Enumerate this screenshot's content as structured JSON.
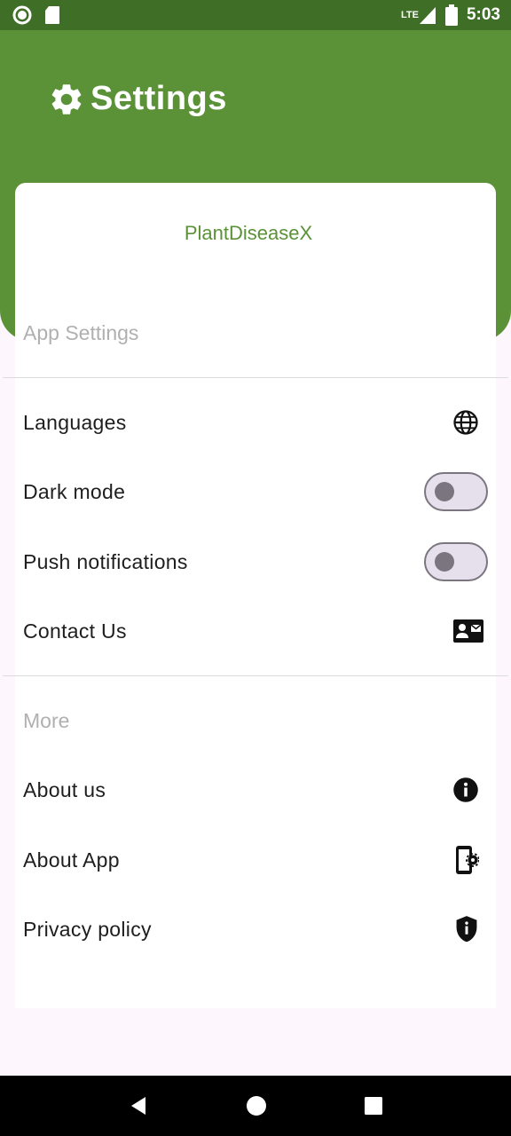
{
  "status_bar": {
    "network": "LTE",
    "time": "5:03",
    "icons": [
      "circle-status-icon",
      "sd-card-icon",
      "signal-icon",
      "battery-icon"
    ]
  },
  "header": {
    "title": "Settings",
    "icon": "gear-icon",
    "color": "#5b9238"
  },
  "app": {
    "name": "PlantDiseaseX"
  },
  "sections": {
    "app_settings": {
      "label": "App Settings",
      "items": {
        "languages": {
          "label": "Languages",
          "icon": "globe-icon"
        },
        "dark_mode": {
          "label": "Dark mode",
          "enabled": false
        },
        "push_notifications": {
          "label": "Push notifications",
          "enabled": false
        },
        "contact_us": {
          "label": "Contact Us",
          "icon": "contact-card-icon"
        }
      }
    },
    "more": {
      "label": "More",
      "items": {
        "about_us": {
          "label": "About us",
          "icon": "info-icon"
        },
        "about_app": {
          "label": "About App",
          "icon": "phone-settings-icon"
        },
        "privacy_policy": {
          "label": "Privacy policy",
          "icon": "shield-info-icon"
        }
      }
    }
  },
  "nav_bar": {
    "buttons": [
      "back-icon",
      "home-icon",
      "recents-icon"
    ]
  }
}
